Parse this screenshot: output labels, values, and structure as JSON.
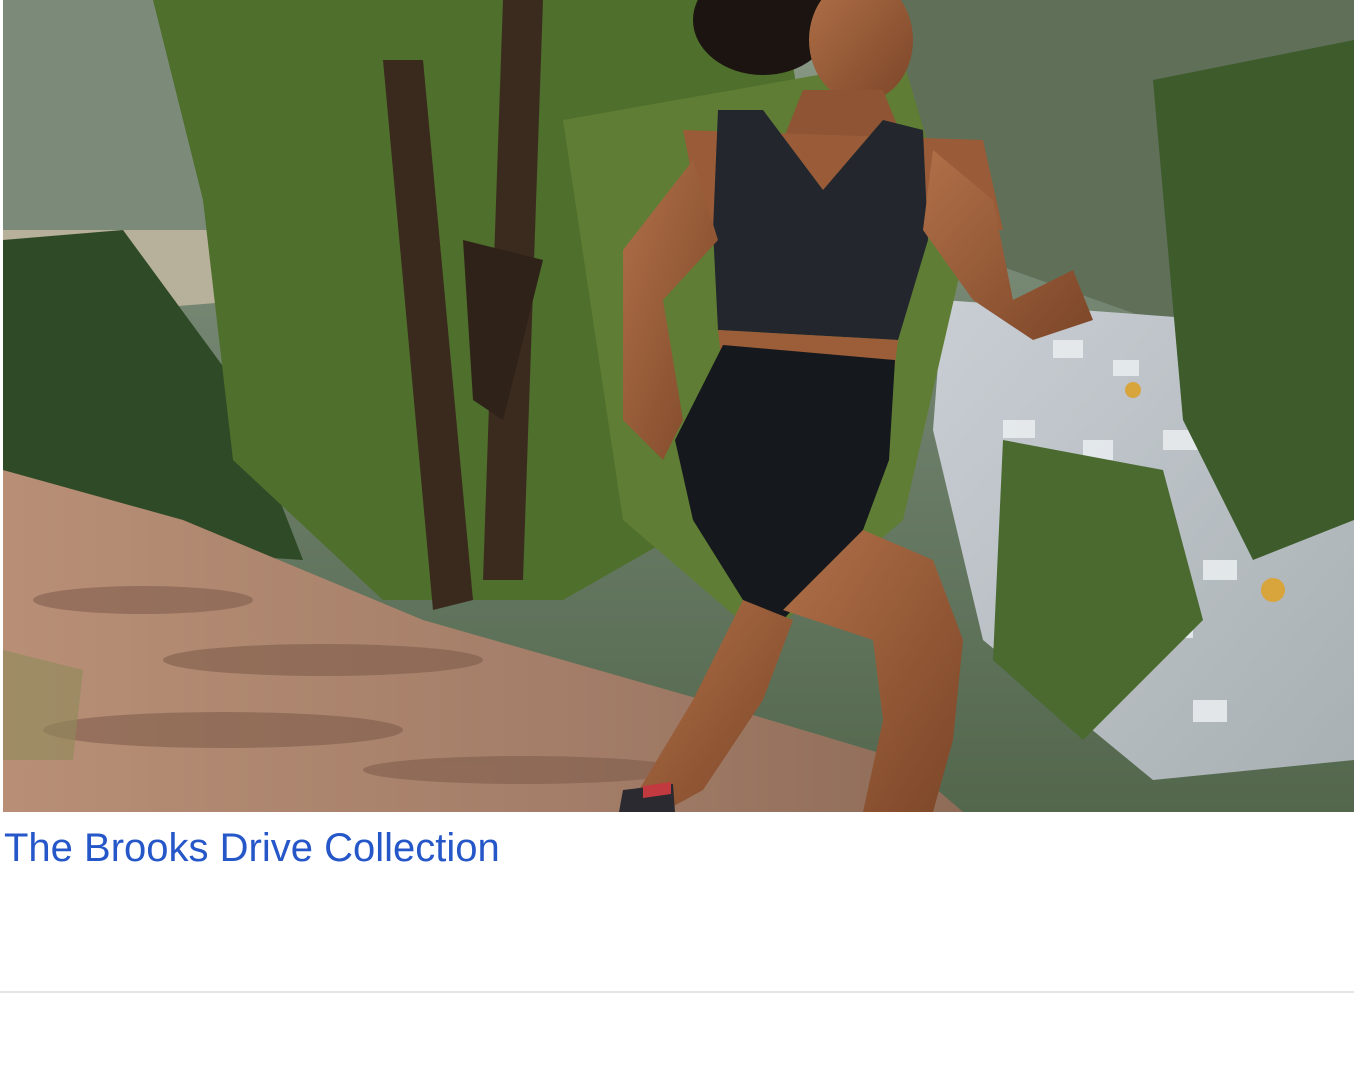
{
  "card": {
    "title": "The Brooks Drive Collection",
    "title_color": "#2557c9",
    "divider_color": "#e6e6e6"
  },
  "hero_image": {
    "alt": "The Brooks Drive Collection"
  }
}
